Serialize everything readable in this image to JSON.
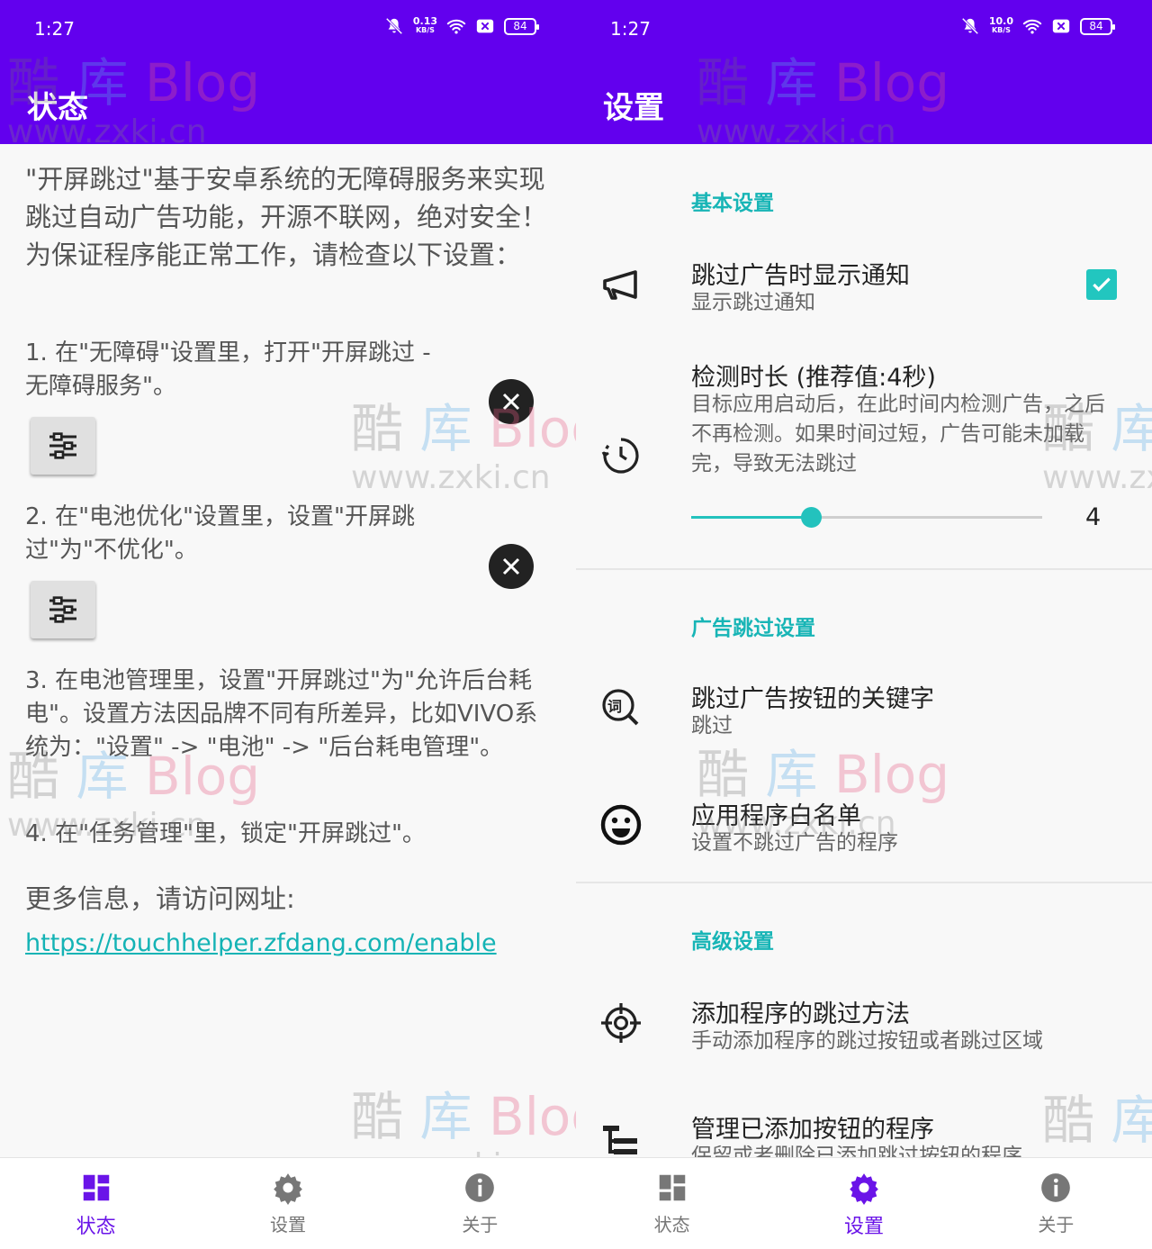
{
  "left": {
    "status": {
      "time": "1:27",
      "speed": "0.13",
      "speed_unit": "KB/S",
      "battery": "84"
    },
    "appbar_title": "状态",
    "intro": "\"开屏跳过\"基于安卓系统的无障碍服务来实现跳过自动广告功能，开源不联网，绝对安全！为保证程序能正常工作，请检查以下设置：",
    "step1": "1. 在\"无障碍\"设置里，打开\"开屏跳过 - 无障碍服务\"。",
    "step2": "2. 在\"电池优化\"设置里，设置\"开屏跳过\"为\"不优化\"。",
    "step3": "3. 在电池管理里，设置\"开屏跳过\"为\"允许后台耗电\"。设置方法因品牌不同有所差异，比如VIVO系统为：\"设置\" -> \"电池\" -> \"后台耗电管理\"。",
    "step4": "4. 在\"任务管理\"里，锁定\"开屏跳过\"。",
    "more": "更多信息，请访问网址:",
    "link": "https://touchhelper.zfdang.com/enable"
  },
  "right": {
    "status": {
      "time": "1:27",
      "speed": "10.0",
      "speed_unit": "KB/S",
      "battery": "84"
    },
    "appbar_title": "设置",
    "cat_basic": "基本设置",
    "notify_title": "跳过广告时显示通知",
    "notify_summary": "显示跳过通知",
    "notify_checked": true,
    "duration_title": "检测时长 (推荐值:4秒)",
    "duration_summary": "目标应用启动后，在此时间内检测广告，之后不再检测。如果时间过短，广告可能未加载完，导致无法跳过",
    "duration_value": "4",
    "duration_fraction": 0.34,
    "cat_ad": "广告跳过设置",
    "keyword_title": "跳过广告按钮的关键字",
    "keyword_summary": "跳过",
    "keyword_icon_char": "词",
    "whitelist_title": "应用程序白名单",
    "whitelist_summary": "设置不跳过广告的程序",
    "cat_advanced": "高级设置",
    "method_title": "添加程序的跳过方法",
    "method_summary": "手动添加程序的跳过按钮或者跳过区域",
    "manage_title": "管理已添加按钮的程序",
    "manage_summary": "保留或者删除已添加跳过按钮的程序"
  },
  "nav": {
    "status": "状态",
    "settings": "设置",
    "about": "关于"
  },
  "watermark": {
    "brand_a": "酷",
    "brand_b": "库",
    "brand_c": "Blog",
    "url": "www.zxki.cn"
  },
  "colors": {
    "primary": "#6200ee",
    "accent": "#18b5b6",
    "nav_active": "#6a14e8"
  }
}
